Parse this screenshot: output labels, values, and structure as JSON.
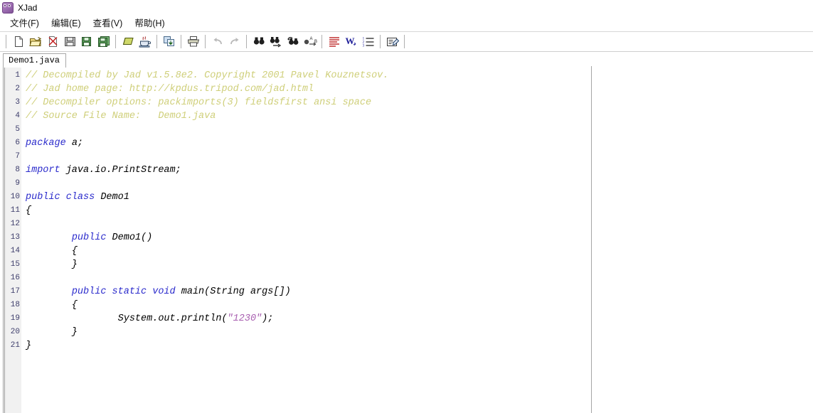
{
  "window": {
    "title": "XJad",
    "icon": "xjad-app-icon"
  },
  "menubar": {
    "items": [
      {
        "label": "文件(F)",
        "name": "menu-file"
      },
      {
        "label": "编辑(E)",
        "name": "menu-edit"
      },
      {
        "label": "查看(V)",
        "name": "menu-view"
      },
      {
        "label": "帮助(H)",
        "name": "menu-help"
      }
    ]
  },
  "toolbar": {
    "groups": [
      {
        "buttons": [
          {
            "icon": "new-file-icon",
            "tooltip": "New"
          },
          {
            "icon": "open-folder-icon",
            "tooltip": "Open"
          },
          {
            "icon": "close-file-icon",
            "tooltip": "Close"
          },
          {
            "icon": "save-icon",
            "tooltip": "Save"
          },
          {
            "icon": "save-as-icon",
            "tooltip": "Save As"
          },
          {
            "icon": "save-all-icon",
            "tooltip": "Save All"
          }
        ]
      },
      {
        "buttons": [
          {
            "icon": "decompile-icon",
            "tooltip": "Decompile"
          },
          {
            "icon": "java-coffee-icon",
            "tooltip": "Java"
          }
        ]
      },
      {
        "buttons": [
          {
            "icon": "export-icon",
            "tooltip": "Export"
          }
        ]
      },
      {
        "buttons": [
          {
            "icon": "print-icon",
            "tooltip": "Print"
          }
        ]
      },
      {
        "buttons": [
          {
            "icon": "undo-icon",
            "tooltip": "Undo"
          },
          {
            "icon": "redo-icon",
            "tooltip": "Redo"
          }
        ]
      },
      {
        "buttons": [
          {
            "icon": "find-icon",
            "tooltip": "Find"
          },
          {
            "icon": "find-next-icon",
            "tooltip": "Find Next"
          },
          {
            "icon": "find-previous-icon",
            "tooltip": "Find Previous"
          },
          {
            "icon": "replace-icon",
            "tooltip": "Replace"
          }
        ]
      },
      {
        "buttons": [
          {
            "icon": "align-text-icon",
            "tooltip": "Format"
          },
          {
            "icon": "word-wrap-icon",
            "tooltip": "Word Wrap"
          },
          {
            "icon": "line-numbers-icon",
            "tooltip": "Line Numbers"
          }
        ]
      },
      {
        "buttons": [
          {
            "icon": "properties-icon",
            "tooltip": "Options"
          }
        ]
      }
    ]
  },
  "tabs": [
    {
      "label": "Demo1.java",
      "active": true
    }
  ],
  "editor": {
    "line_numbers": [
      1,
      2,
      3,
      4,
      5,
      6,
      7,
      8,
      9,
      10,
      11,
      12,
      13,
      14,
      15,
      16,
      17,
      18,
      19,
      20,
      21
    ],
    "lines": [
      {
        "n": 1,
        "tokens": [
          {
            "t": "comment",
            "s": "// Decompiled by Jad v1.5.8e2. Copyright 2001 Pavel Kouznetsov."
          }
        ]
      },
      {
        "n": 2,
        "tokens": [
          {
            "t": "comment",
            "s": "// Jad home page: http://kpdus.tripod.com/jad.html"
          }
        ]
      },
      {
        "n": 3,
        "tokens": [
          {
            "t": "comment",
            "s": "// Decompiler options: packimports(3) fieldsfirst ansi space"
          }
        ]
      },
      {
        "n": 4,
        "tokens": [
          {
            "t": "comment",
            "s": "// Source File Name:   Demo1.java"
          }
        ]
      },
      {
        "n": 5,
        "tokens": []
      },
      {
        "n": 6,
        "tokens": [
          {
            "t": "kw",
            "s": "package"
          },
          {
            "t": "plain",
            "s": " a;"
          }
        ]
      },
      {
        "n": 7,
        "tokens": []
      },
      {
        "n": 8,
        "tokens": [
          {
            "t": "kw",
            "s": "import"
          },
          {
            "t": "plain",
            "s": " java.io.PrintStream;"
          }
        ]
      },
      {
        "n": 9,
        "tokens": []
      },
      {
        "n": 10,
        "tokens": [
          {
            "t": "kw",
            "s": "public class"
          },
          {
            "t": "plain",
            "s": " Demo1"
          }
        ]
      },
      {
        "n": 11,
        "tokens": [
          {
            "t": "plain",
            "s": "{"
          }
        ]
      },
      {
        "n": 12,
        "tokens": []
      },
      {
        "n": 13,
        "tokens": [
          {
            "t": "plain",
            "s": "        "
          },
          {
            "t": "kw",
            "s": "public"
          },
          {
            "t": "plain",
            "s": " Demo1()"
          }
        ]
      },
      {
        "n": 14,
        "tokens": [
          {
            "t": "plain",
            "s": "        {"
          }
        ]
      },
      {
        "n": 15,
        "tokens": [
          {
            "t": "plain",
            "s": "        }"
          }
        ]
      },
      {
        "n": 16,
        "tokens": []
      },
      {
        "n": 17,
        "tokens": [
          {
            "t": "plain",
            "s": "        "
          },
          {
            "t": "kw",
            "s": "public static void"
          },
          {
            "t": "plain",
            "s": " main(String args[])"
          }
        ]
      },
      {
        "n": 18,
        "tokens": [
          {
            "t": "plain",
            "s": "        {"
          }
        ]
      },
      {
        "n": 19,
        "tokens": [
          {
            "t": "plain",
            "s": "                System.out.println("
          },
          {
            "t": "str",
            "s": "\"1230\""
          },
          {
            "t": "plain",
            "s": ");"
          }
        ]
      },
      {
        "n": 20,
        "tokens": [
          {
            "t": "plain",
            "s": "        }"
          }
        ]
      },
      {
        "n": 21,
        "tokens": [
          {
            "t": "plain",
            "s": "}"
          }
        ]
      }
    ]
  },
  "colors": {
    "comment": "#cfcf7a",
    "keyword": "#2b2bcc",
    "string": "#a85fb0",
    "plain": "#000000",
    "gutter_bg": "#f1f1f1",
    "line_number": "#3d3d6b",
    "editor_bg": "#ffffff"
  }
}
